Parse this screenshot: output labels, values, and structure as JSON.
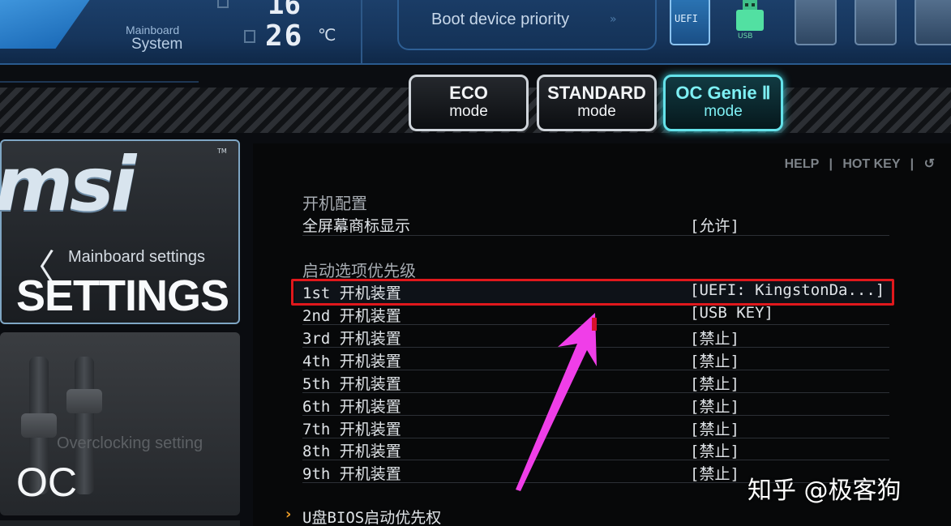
{
  "topbar": {
    "mainboard_label": "Mainboard",
    "system_label": "System",
    "top_value": "16",
    "temperature": "26",
    "temperature_unit": "℃",
    "boot_priority_label": "Boot device priority",
    "boot_chevron": "»",
    "devices": [
      {
        "name": "uefi-device",
        "label": "UEFI"
      },
      {
        "name": "usb-device",
        "label": "USB"
      },
      {
        "name": "empty-device-1",
        "label": ""
      },
      {
        "name": "empty-device-2",
        "label": ""
      },
      {
        "name": "empty-device-3",
        "label": ""
      }
    ]
  },
  "modes": [
    {
      "line1": "ECO",
      "line2": "mode"
    },
    {
      "line1": "STANDARD",
      "line2": "mode"
    },
    {
      "line1": "OC Genie Ⅱ",
      "line2": "mode"
    }
  ],
  "left": {
    "logo": "msi",
    "trademark": "TM",
    "mainboard_settings": "Mainboard settings",
    "settings": "SETTINGS",
    "overclocking_setting": "Overclocking setting",
    "oc": "OC",
    "back_chevron": "〈"
  },
  "help_bar": {
    "help": "HELP",
    "hot_key": "HOT KEY",
    "separator": "|",
    "back_icon": "↺"
  },
  "boot_config": {
    "section_title": "开机配置",
    "fullscreen_logo_label": "全屏幕商标显示",
    "fullscreen_logo_value": "[允许]"
  },
  "boot_priority": {
    "section_title": "启动选项优先级",
    "items": [
      {
        "label": "1st 开机装置",
        "value": "[UEFI: KingstonDa...]"
      },
      {
        "label": "2nd 开机装置",
        "value": "[USB KEY]"
      },
      {
        "label": "3rd 开机装置",
        "value": "[禁止]"
      },
      {
        "label": "4th 开机装置",
        "value": "[禁止]"
      },
      {
        "label": "5th 开机装置",
        "value": "[禁止]"
      },
      {
        "label": "6th 开机装置",
        "value": "[禁止]"
      },
      {
        "label": "7th 开机装置",
        "value": "[禁止]"
      },
      {
        "label": "8th 开机装置",
        "value": "[禁止]"
      },
      {
        "label": "9th 开机装置",
        "value": "[禁止]"
      }
    ]
  },
  "usb_bios": {
    "chevron": "›",
    "label": "U盘BIOS启动优先权"
  },
  "watermark": "知乎 @极客狗",
  "colors": {
    "highlight_box": "#e0181c",
    "arrow": "#f03ee8",
    "oc_genie_accent": "#64e2ea",
    "topbar_blue": "#1c3f6a"
  }
}
